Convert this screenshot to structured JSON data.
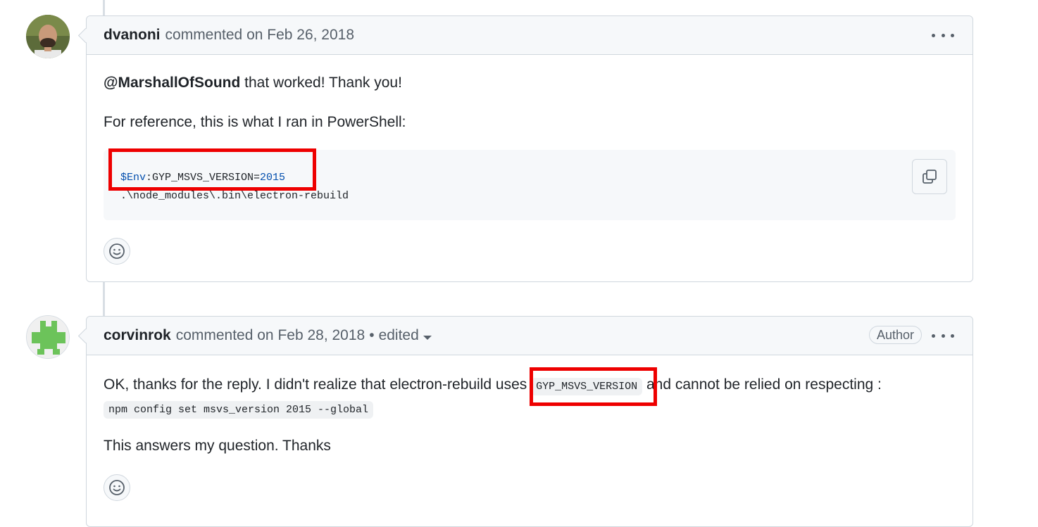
{
  "comments": [
    {
      "author": "dvanoni",
      "header_text": "commented on Feb 26, 2018",
      "mention": "@MarshallOfSound",
      "line1_rest": " that worked! Thank you!",
      "line2": "For reference, this is what I ran in PowerShell:",
      "code": {
        "env_var": "$Env",
        "env_rest": ":GYP_MSVS_VERSION=",
        "env_value": "2015",
        "line2": ".\\node_modules\\.bin\\electron-rebuild"
      }
    },
    {
      "author": "corvinrok",
      "header_text": "commented on Feb 28, 2018",
      "separator": "•",
      "edited_label": "edited",
      "badge": "Author",
      "para1_before": "OK, thanks for the reply. I didn't realize that electron-rebuild uses ",
      "para1_code": "GYP_MSVS_VERSION",
      "para1_after": " and cannot be relied on respecting :",
      "para1_code2": "npm config set msvs_version 2015 --global",
      "para2": "This answers my question. Thanks"
    }
  ],
  "colors": {
    "highlight": "#ee0000",
    "code_number": "#0550ae"
  },
  "icons": [
    "kebab-menu-icon",
    "copy-icon",
    "smiley-icon",
    "caret-down-icon"
  ]
}
